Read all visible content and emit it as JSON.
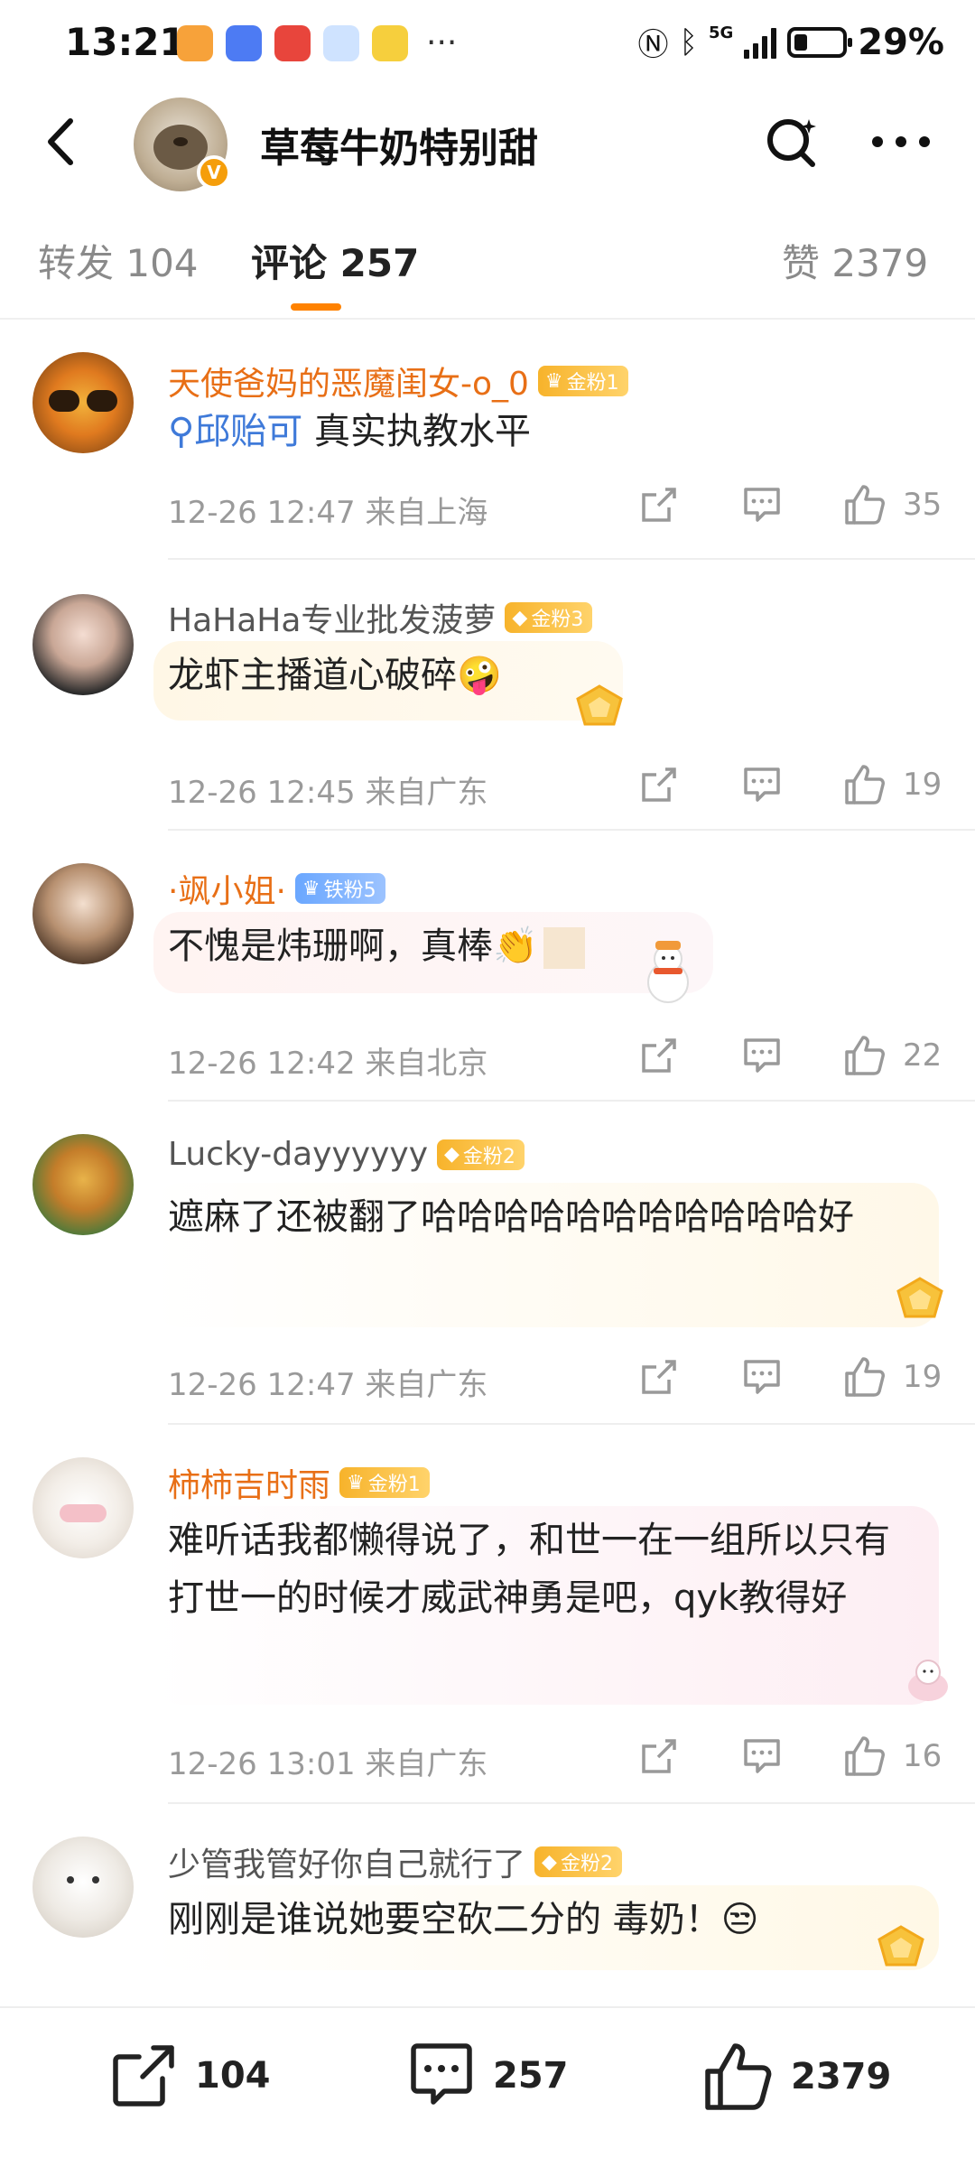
{
  "status_bar": {
    "time": "13:21",
    "network": "5G",
    "battery": "29%",
    "battery_level": 0.29
  },
  "header": {
    "title": "草莓牛奶特别甜",
    "verified_mark": "V"
  },
  "tabs": [
    {
      "label": "转发 104"
    },
    {
      "label": "评论 257"
    },
    {
      "label": "赞 2379"
    }
  ],
  "comments": [
    {
      "username": "天使爸妈的恶魔闺女-o_0",
      "badge": "金粉1",
      "mention": "邱贻可",
      "text": " 真实执教水平",
      "date": "12-26 12:47",
      "location": "来自上海",
      "likes": "35"
    },
    {
      "username": "HaHaHa专业批发菠萝",
      "badge": "金粉3",
      "text": "龙虾主播道心破碎",
      "emoji": "🤪",
      "date": "12-26 12:45",
      "location": "来自广东",
      "likes": "19"
    },
    {
      "username": "·飒小姐·",
      "badge": "铁粉5",
      "text": "不愧是炜珊啊，真棒",
      "emoji": "👏",
      "date": "12-26 12:42",
      "location": "来自北京",
      "likes": "22"
    },
    {
      "username": "Lucky-dayyyyyy",
      "badge": "金粉2",
      "text": "遮麻了还被翻了哈哈哈哈哈哈哈哈哈哈哈好",
      "date": "12-26 12:47",
      "location": "来自广东",
      "likes": "19"
    },
    {
      "username": "柿柿吉时雨",
      "badge": "金粉1",
      "text": "难听话我都懒得说了，和世一在一组所以只有打世一的时候才威武神勇是吧，qyk教得好",
      "date": "12-26 13:01",
      "location": "来自广东",
      "likes": "16"
    },
    {
      "username": "少管我管好你自己就行了",
      "badge": "金粉2",
      "text": "刚刚是谁说她要空砍二分的  毒奶！",
      "emoji": "😒"
    }
  ],
  "bottom_bar": {
    "repost_count": "104",
    "comment_count": "257",
    "like_count": "2379"
  },
  "colors": {
    "accent": "#ff8200",
    "username_orange": "#e86f16",
    "mention_blue": "#3f7ad9",
    "muted": "#9a9a9a"
  },
  "icons": [
    "back-icon",
    "search-icon",
    "more-icon",
    "share-icon",
    "reply-icon",
    "like-icon"
  ]
}
